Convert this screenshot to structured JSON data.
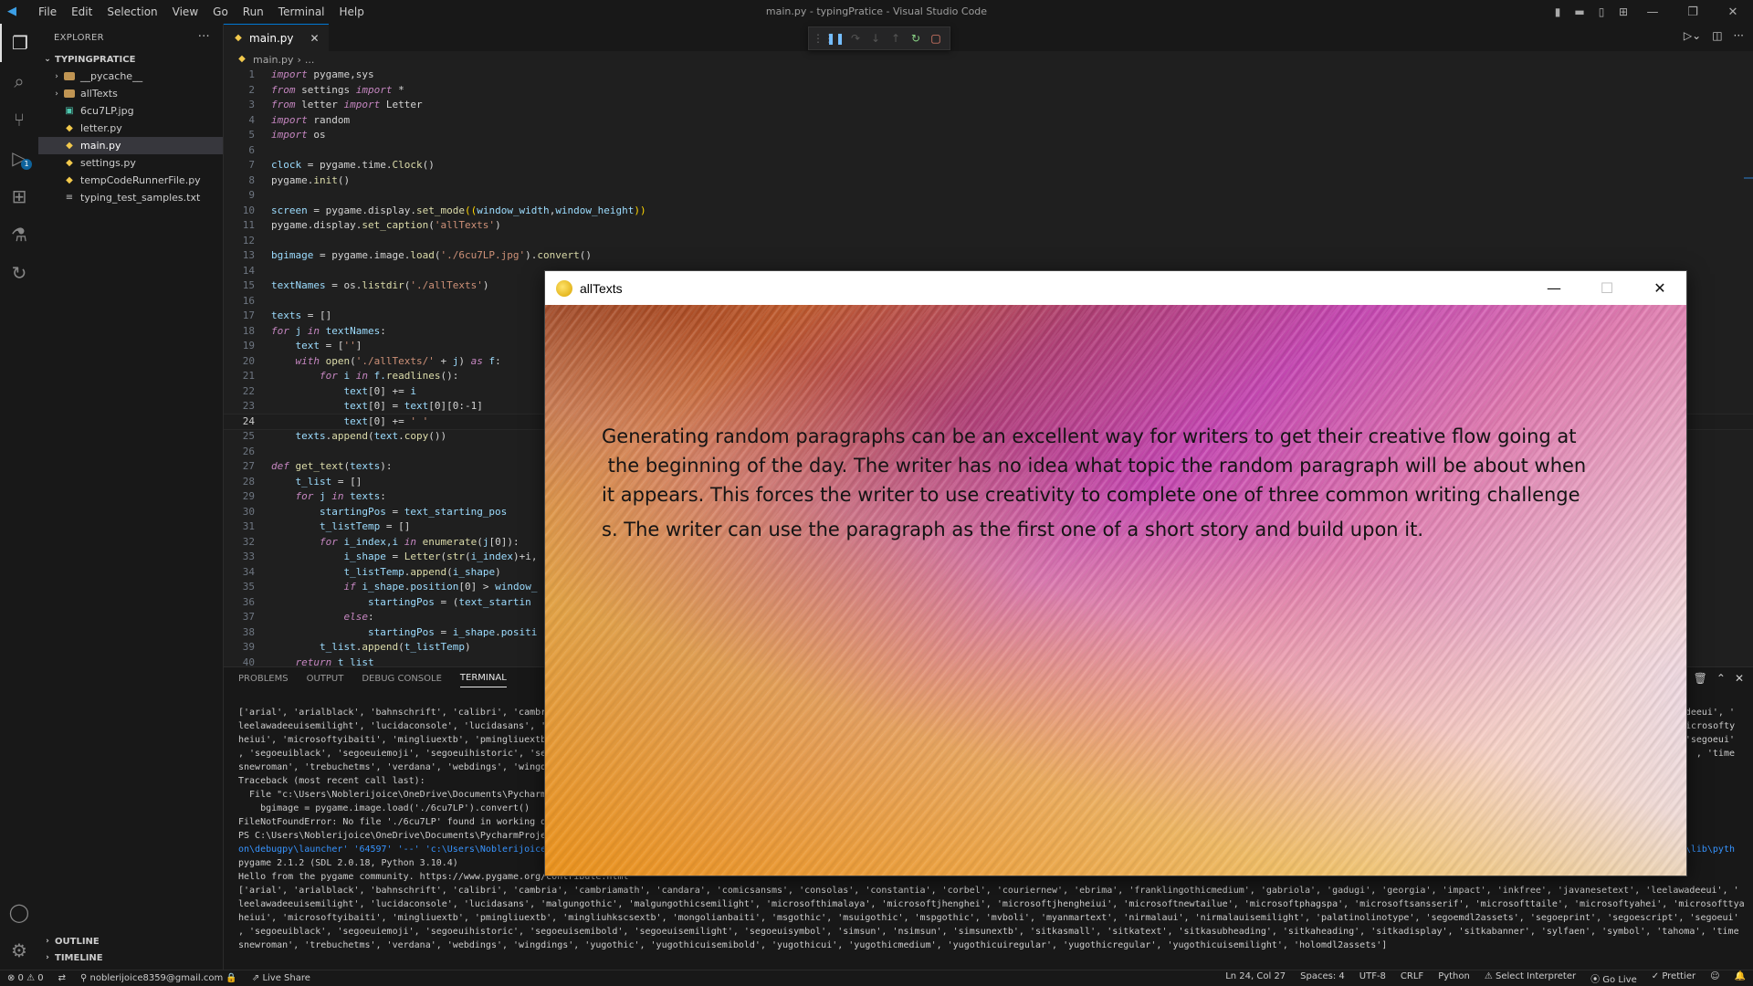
{
  "titlebar": {
    "menu": [
      "File",
      "Edit",
      "Selection",
      "View",
      "Go",
      "Run",
      "Terminal",
      "Help"
    ],
    "title": "main.py - typingPratice - Visual Studio Code",
    "icons": [
      "layout-sidebar-icon",
      "layout-panel-icon",
      "layout-sidebar-right-icon",
      "customize-layout-icon"
    ]
  },
  "activity_bar": {
    "icons": [
      "explorer-icon",
      "search-icon",
      "source-control-icon",
      "run-debug-icon",
      "extensions-icon",
      "testing-icon",
      "remote-icon"
    ],
    "debug_badge": "1",
    "bottom_icons": [
      "account-icon",
      "settings-gear-icon"
    ]
  },
  "explorer": {
    "header": "EXPLORER",
    "more": "···",
    "project": "TYPINGPRATICE",
    "items": [
      {
        "label": "__pycache__",
        "type": "folder"
      },
      {
        "label": "allTexts",
        "type": "folder"
      },
      {
        "label": "6cu7LP.jpg",
        "type": "image"
      },
      {
        "label": "letter.py",
        "type": "python"
      },
      {
        "label": "main.py",
        "type": "python"
      },
      {
        "label": "settings.py",
        "type": "python"
      },
      {
        "label": "tempCodeRunnerFile.py",
        "type": "python"
      },
      {
        "label": "typing_test_samples.txt",
        "type": "text"
      }
    ],
    "outline": "OUTLINE",
    "timeline": "TIMELINE"
  },
  "editor": {
    "tab_label": "main.py",
    "breadcrumb": [
      "main.py",
      "..."
    ],
    "current_line": "24",
    "code": [
      [
        [
          "k",
          "import"
        ],
        [
          "d",
          " pygame,sys"
        ]
      ],
      [
        [
          "k",
          "from"
        ],
        [
          "d",
          " settings "
        ],
        [
          "k",
          "import"
        ],
        [
          "d",
          " *"
        ]
      ],
      [
        [
          "k",
          "from"
        ],
        [
          "d",
          " letter "
        ],
        [
          "k",
          "import"
        ],
        [
          "d",
          " Letter"
        ]
      ],
      [
        [
          "k",
          "import"
        ],
        [
          "d",
          " random"
        ]
      ],
      [
        [
          "k",
          "import"
        ],
        [
          "d",
          " os"
        ]
      ],
      [],
      [
        [
          "v",
          "clock"
        ],
        [
          "d",
          " = pygame.time."
        ],
        [
          "f",
          "Clock"
        ],
        [
          "d",
          "()"
        ]
      ],
      [
        [
          "d",
          "pygame."
        ],
        [
          "f",
          "init"
        ],
        [
          "d",
          "()"
        ]
      ],
      [],
      [
        [
          "v",
          "screen"
        ],
        [
          "d",
          " = pygame.display."
        ],
        [
          "f",
          "set_mode"
        ],
        [
          "y",
          "(("
        ],
        [
          "v",
          "window_width"
        ],
        [
          "d",
          ","
        ],
        [
          "v",
          "window_height"
        ],
        [
          "y",
          "))"
        ]
      ],
      [
        [
          "d",
          "pygame.display."
        ],
        [
          "f",
          "set_caption"
        ],
        [
          "d",
          "("
        ],
        [
          "s",
          "'allTexts'"
        ],
        [
          "d",
          ")"
        ]
      ],
      [],
      [
        [
          "v",
          "bgimage"
        ],
        [
          "d",
          " = pygame.image."
        ],
        [
          "f",
          "load"
        ],
        [
          "d",
          "("
        ],
        [
          "s",
          "'./6cu7LP.jpg'"
        ],
        [
          "d",
          ")."
        ],
        [
          "f",
          "convert"
        ],
        [
          "d",
          "()"
        ]
      ],
      [],
      [
        [
          "v",
          "textNames"
        ],
        [
          "d",
          " = os."
        ],
        [
          "f",
          "listdir"
        ],
        [
          "d",
          "("
        ],
        [
          "s",
          "'./allTexts'"
        ],
        [
          "d",
          ")"
        ]
      ],
      [],
      [
        [
          "v",
          "texts"
        ],
        [
          "d",
          " = []"
        ]
      ],
      [
        [
          "k",
          "for"
        ],
        [
          "v",
          " j "
        ],
        [
          "k",
          "in"
        ],
        [
          "v",
          " textNames"
        ],
        [
          "d",
          ":"
        ]
      ],
      [
        [
          "d",
          "    "
        ],
        [
          "v",
          "text"
        ],
        [
          "d",
          " = ["
        ],
        [
          "s",
          "''"
        ],
        [
          "d",
          "]"
        ]
      ],
      [
        [
          "d",
          "    "
        ],
        [
          "k",
          "with"
        ],
        [
          "d",
          " "
        ],
        [
          "f",
          "open"
        ],
        [
          "d",
          "("
        ],
        [
          "s",
          "'./allTexts/'"
        ],
        [
          "d",
          " + "
        ],
        [
          "v",
          "j"
        ],
        [
          "d",
          ") "
        ],
        [
          "k",
          "as"
        ],
        [
          "v",
          " f"
        ],
        [
          "d",
          ":"
        ]
      ],
      [
        [
          "d",
          "        "
        ],
        [
          "k",
          "for"
        ],
        [
          "v",
          " i "
        ],
        [
          "k",
          "in"
        ],
        [
          "v",
          " f."
        ],
        [
          "f",
          "readlines"
        ],
        [
          "d",
          "():"
        ]
      ],
      [
        [
          "d",
          "            "
        ],
        [
          "v",
          "text"
        ],
        [
          "d",
          "[0] += "
        ],
        [
          "v",
          "i"
        ]
      ],
      [
        [
          "d",
          "            "
        ],
        [
          "v",
          "text"
        ],
        [
          "d",
          "[0] = "
        ],
        [
          "v",
          "text"
        ],
        [
          "d",
          "[0][0:-1]"
        ]
      ],
      [
        [
          "d",
          "            "
        ],
        [
          "v",
          "text"
        ],
        [
          "d",
          "[0] += "
        ],
        [
          "s",
          "' '"
        ]
      ],
      [
        [
          "d",
          "    "
        ],
        [
          "v",
          "texts"
        ],
        [
          "d",
          "."
        ],
        [
          "f",
          "append"
        ],
        [
          "d",
          "("
        ],
        [
          "v",
          "text"
        ],
        [
          "d",
          "."
        ],
        [
          "f",
          "copy"
        ],
        [
          "d",
          "())"
        ]
      ],
      [],
      [
        [
          "k",
          "def"
        ],
        [
          "d",
          " "
        ],
        [
          "f",
          "get_text"
        ],
        [
          "d",
          "("
        ],
        [
          "v",
          "texts"
        ],
        [
          "d",
          "):"
        ]
      ],
      [
        [
          "d",
          "    "
        ],
        [
          "v",
          "t_list"
        ],
        [
          "d",
          " = []"
        ]
      ],
      [
        [
          "d",
          "    "
        ],
        [
          "k",
          "for"
        ],
        [
          "v",
          " j "
        ],
        [
          "k",
          "in"
        ],
        [
          "v",
          " texts"
        ],
        [
          "d",
          ":"
        ]
      ],
      [
        [
          "d",
          "        "
        ],
        [
          "v",
          "startingPos"
        ],
        [
          "d",
          " = "
        ],
        [
          "v",
          "text_starting_pos"
        ]
      ],
      [
        [
          "d",
          "        "
        ],
        [
          "v",
          "t_listTemp"
        ],
        [
          "d",
          " = []"
        ]
      ],
      [
        [
          "d",
          "        "
        ],
        [
          "k",
          "for"
        ],
        [
          "v",
          " i_index,i "
        ],
        [
          "k",
          "in"
        ],
        [
          "d",
          " "
        ],
        [
          "f",
          "enumerate"
        ],
        [
          "d",
          "("
        ],
        [
          "v",
          "j"
        ],
        [
          "d",
          "[0]):"
        ]
      ],
      [
        [
          "d",
          "            "
        ],
        [
          "v",
          "i_shape"
        ],
        [
          "d",
          " = "
        ],
        [
          "f",
          "Letter"
        ],
        [
          "d",
          "("
        ],
        [
          "f",
          "str"
        ],
        [
          "d",
          "("
        ],
        [
          "v",
          "i_index"
        ],
        [
          "d",
          ")+i,"
        ]
      ],
      [
        [
          "d",
          "            "
        ],
        [
          "v",
          "t_listTemp"
        ],
        [
          "d",
          "."
        ],
        [
          "f",
          "append"
        ],
        [
          "d",
          "("
        ],
        [
          "v",
          "i_shape"
        ],
        [
          "d",
          ")"
        ]
      ],
      [
        [
          "d",
          "            "
        ],
        [
          "k",
          "if"
        ],
        [
          "v",
          " i_shape"
        ],
        [
          "d",
          "."
        ],
        [
          "v",
          "position"
        ],
        [
          "d",
          "[0] > "
        ],
        [
          "v",
          "window_"
        ]
      ],
      [
        [
          "d",
          "                "
        ],
        [
          "v",
          "startingPos"
        ],
        [
          "d",
          " = ("
        ],
        [
          "v",
          "text_startin"
        ]
      ],
      [
        [
          "d",
          "            "
        ],
        [
          "k",
          "else"
        ],
        [
          "d",
          ":"
        ]
      ],
      [
        [
          "d",
          "                "
        ],
        [
          "v",
          "startingPos"
        ],
        [
          "d",
          " = "
        ],
        [
          "v",
          "i_shape"
        ],
        [
          "d",
          "."
        ],
        [
          "v",
          "positi"
        ]
      ],
      [
        [
          "d",
          "        "
        ],
        [
          "v",
          "t_list"
        ],
        [
          "d",
          "."
        ],
        [
          "f",
          "append"
        ],
        [
          "d",
          "("
        ],
        [
          "v",
          "t_listTemp"
        ],
        [
          "d",
          ")"
        ]
      ],
      [
        [
          "d",
          "    "
        ],
        [
          "k",
          "return"
        ],
        [
          "v",
          " t_list"
        ]
      ]
    ]
  },
  "panel": {
    "tabs": [
      "PROBLEMS",
      "OUTPUT",
      "DEBUG CONSOLE",
      "TERMINAL"
    ],
    "active_tab": "TERMINAL",
    "terminal_lines": [
      "['arial', 'arialblack', 'bahnschrift', 'calibri', 'cambr",
      "leelawadeeuisemilight', 'lucidaconsole', 'lucidasans', '",
      "heiui', 'microsoftyibaiti', 'mingliuextb', 'pmingliuextb",
      ", 'segoeuiblack', 'segoeuiemoji', 'segoeuihistoric', 'se",
      "snewroman', 'trebuchetms', 'verdana', 'webdings', 'wingd",
      "Traceback (most recent call last):",
      "  File \"c:\\Users\\Noblerijoice\\OneDrive\\Documents\\Pycharm",
      "    bgimage = pygame.image.load('./6cu7LP').convert()",
      "FileNotFoundError: No file './6cu7LP' found in working d",
      "PS C:\\Users\\Noblerijoice\\OneDrive\\Documents\\PycharmProje",
      "on\\debugpy\\launcher' '64597' '--' 'c:\\Users\\Noblerijoice",
      "pygame 2.1.2 (SDL 2.0.18, Python 3.10.4)",
      "Hello from the pygame community. https://www.pygame.org/contribute.html",
      "['arial', 'arialblack', 'bahnschrift', 'calibri', 'cambria', 'cambriamath', 'candara', 'comicsansms', 'consolas', 'constantia', 'corbel', 'couriernew', 'ebrima', 'franklingothicmedium', 'gabriola', 'gadugi', 'georgia', 'impact', 'inkfree', 'javanesetext', 'leelawadeeui', '",
      "leelawadeeuisemilight', 'lucidaconsole', 'lucidasans', 'malgungothic', 'malgungothicsemilight', 'microsofthimalaya', 'microsoftjhenghei', 'microsoftjhengheiui', 'microsoftnewtailue', 'microsoftphagspa', 'microsoftsansserif', 'microsofttaile', 'microsoftyahei', 'microsofttya",
      "heiui', 'microsoftyibaiti', 'mingliuextb', 'pmingliuextb', 'mingliuhkscsextb', 'mongolianbaiti', 'msgothic', 'msuigothic', 'mspgothic', 'mvboli', 'myanmartext', 'nirmalaui', 'nirmalauisemilight', 'palatinolinotype', 'segoemdl2assets', 'segoeprint', 'segoescript', 'segoeui'",
      ", 'segoeuiblack', 'segoeuiemoji', 'segoeuihistoric', 'segoeuisemibold', 'segoeuisemilight', 'segoeuisymbol', 'simsun', 'nsimsun', 'simsunextb', 'sitkasmall', 'sitkatext', 'sitkasubheading', 'sitkaheading', 'sitkadisplay', 'sitkabanner', 'sylfaen', 'symbol', 'tahoma', 'time",
      "snewroman', 'trebuchetms', 'verdana', 'webdings', 'wingdings', 'yugothic', 'yugothicuisemibold', 'yugothicui', 'yugothicmedium', 'yugothicuiregular', 'yugothicregular', 'yugothicuisemilight', 'holomdl2assets']"
    ],
    "terminal_right": [
      "deeui', '",
      "microsoftya",
      "'segoeui'",
      ", 'time",
      "",
      "",
      "",
      "",
      "",
      "",
      "\\lib\\pyth"
    ]
  },
  "statusbar": {
    "errors": "⊗ 0 ⚠ 0",
    "account": "noblerijoice8359@gmail.com",
    "live_share": "Live Share",
    "position": "Ln 24, Col 27",
    "spaces": "Spaces: 4",
    "encoding": "UTF-8",
    "eol": "CRLF",
    "language": "Python",
    "interpreter": "Select Interpreter",
    "go_live": "Go Live",
    "prettier": "Prettier"
  },
  "pygame_window": {
    "title": "allTexts",
    "paragraph_lines": [
      "Generating random paragraphs can be an excellent way for writers to get their creative flow going at",
      " the beginning of the day. The writer has no idea what topic the random paragraph will be about when",
      "it appears. This forces the writer to use creativity to complete one of three common writing challenge",
      "s. The writer can use the paragraph as the first one of a short story and build upon it."
    ]
  }
}
